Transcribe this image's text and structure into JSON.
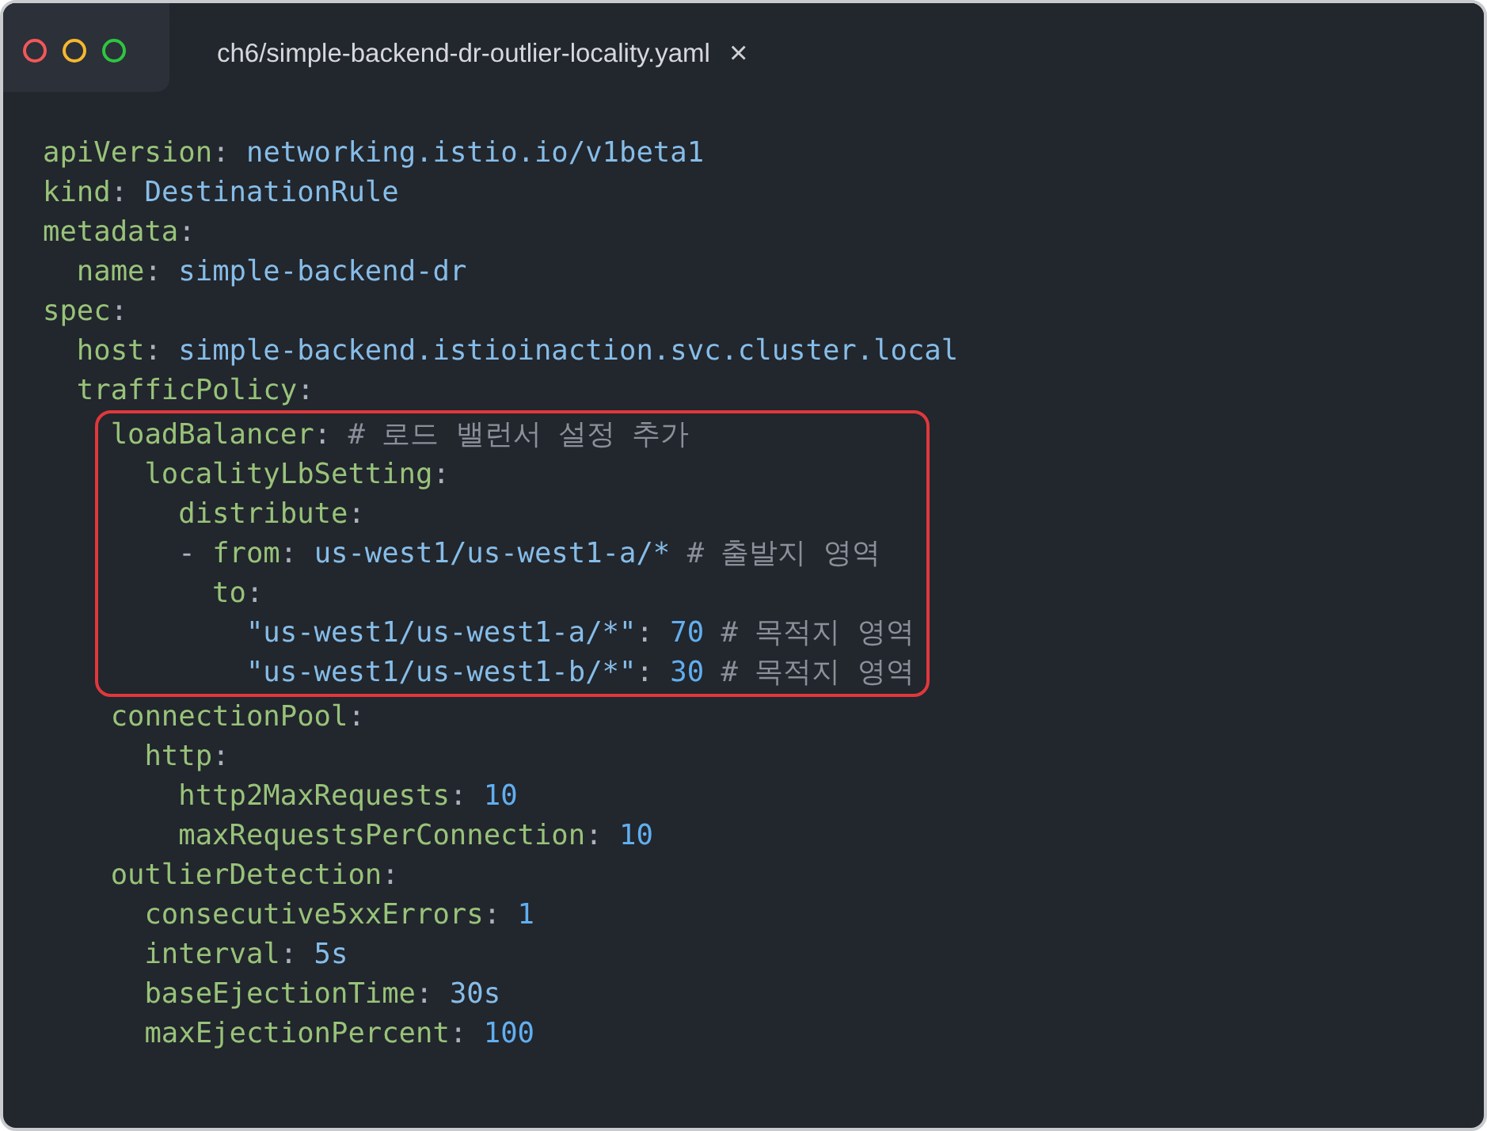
{
  "window": {
    "controls": [
      {
        "kind": "close"
      },
      {
        "kind": "minimize"
      },
      {
        "kind": "zoom"
      }
    ]
  },
  "tabs": [
    {
      "label": "ch6/simple-backend-dr-outlier-locality.yaml",
      "selected": true,
      "close": "×"
    }
  ],
  "code": {
    "blocks": [
      {
        "highlighted": false,
        "lines": [
          [
            {
              "kind": "key",
              "text": "apiVersion"
            },
            {
              "kind": "punct",
              "text": ": "
            },
            {
              "kind": "value",
              "text": "networking.istio.io/v1beta1"
            }
          ],
          [
            {
              "kind": "key",
              "text": "kind"
            },
            {
              "kind": "punct",
              "text": ": "
            },
            {
              "kind": "value",
              "text": "DestinationRule"
            }
          ],
          [
            {
              "kind": "key",
              "text": "metadata"
            },
            {
              "kind": "punct",
              "text": ":"
            }
          ],
          [
            {
              "kind": "key",
              "text": "  name"
            },
            {
              "kind": "punct",
              "text": ": "
            },
            {
              "kind": "value",
              "text": "simple-backend-dr"
            }
          ],
          [
            {
              "kind": "key",
              "text": "spec"
            },
            {
              "kind": "punct",
              "text": ":"
            }
          ],
          [
            {
              "kind": "key",
              "text": "  host"
            },
            {
              "kind": "punct",
              "text": ": "
            },
            {
              "kind": "value",
              "text": "simple-backend.istioinaction.svc.cluster.local"
            }
          ],
          [
            {
              "kind": "key",
              "text": "  trafficPolicy"
            },
            {
              "kind": "punct",
              "text": ":"
            }
          ]
        ]
      },
      {
        "highlighted": true,
        "lines": [
          [
            {
              "kind": "key",
              "text": "    loadBalancer"
            },
            {
              "kind": "punct",
              "text": ": "
            },
            {
              "kind": "comment",
              "text": "# 로드 밸런서 설정 추가"
            }
          ],
          [
            {
              "kind": "key",
              "text": "      localityLbSetting"
            },
            {
              "kind": "punct",
              "text": ":"
            }
          ],
          [
            {
              "kind": "key",
              "text": "        distribute"
            },
            {
              "kind": "punct",
              "text": ":"
            }
          ],
          [
            {
              "kind": "punct",
              "text": "        - "
            },
            {
              "kind": "key",
              "text": "from"
            },
            {
              "kind": "punct",
              "text": ": "
            },
            {
              "kind": "value",
              "text": "us-west1/us-west1-a/*"
            },
            {
              "kind": "comment",
              "text": " # 출발지 영역"
            }
          ],
          [
            {
              "kind": "key",
              "text": "          to"
            },
            {
              "kind": "punct",
              "text": ":"
            }
          ],
          [
            {
              "kind": "value",
              "text": "            \"us-west1/us-west1-a/*\""
            },
            {
              "kind": "punct",
              "text": ": "
            },
            {
              "kind": "number",
              "text": "70"
            },
            {
              "kind": "comment",
              "text": " # 목적지 영역"
            }
          ],
          [
            {
              "kind": "value",
              "text": "            \"us-west1/us-west1-b/*\""
            },
            {
              "kind": "punct",
              "text": ": "
            },
            {
              "kind": "number",
              "text": "30"
            },
            {
              "kind": "comment",
              "text": " # 목적지 영역"
            }
          ]
        ]
      },
      {
        "highlighted": false,
        "lines": [
          [
            {
              "kind": "key",
              "text": "    connectionPool"
            },
            {
              "kind": "punct",
              "text": ":"
            }
          ],
          [
            {
              "kind": "key",
              "text": "      http"
            },
            {
              "kind": "punct",
              "text": ":"
            }
          ],
          [
            {
              "kind": "key",
              "text": "        http2MaxRequests"
            },
            {
              "kind": "punct",
              "text": ": "
            },
            {
              "kind": "number",
              "text": "10"
            }
          ],
          [
            {
              "kind": "key",
              "text": "        maxRequestsPerConnection"
            },
            {
              "kind": "punct",
              "text": ": "
            },
            {
              "kind": "number",
              "text": "10"
            }
          ],
          [
            {
              "kind": "key",
              "text": "    outlierDetection"
            },
            {
              "kind": "punct",
              "text": ":"
            }
          ],
          [
            {
              "kind": "key",
              "text": "      consecutive5xxErrors"
            },
            {
              "kind": "punct",
              "text": ": "
            },
            {
              "kind": "number",
              "text": "1"
            }
          ],
          [
            {
              "kind": "key",
              "text": "      interval"
            },
            {
              "kind": "punct",
              "text": ": "
            },
            {
              "kind": "value",
              "text": "5s"
            }
          ],
          [
            {
              "kind": "key",
              "text": "      baseEjectionTime"
            },
            {
              "kind": "punct",
              "text": ": "
            },
            {
              "kind": "value",
              "text": "30s"
            }
          ],
          [
            {
              "kind": "key",
              "text": "      maxEjectionPercent"
            },
            {
              "kind": "punct",
              "text": ": "
            },
            {
              "kind": "number",
              "text": "100"
            }
          ]
        ]
      }
    ]
  }
}
